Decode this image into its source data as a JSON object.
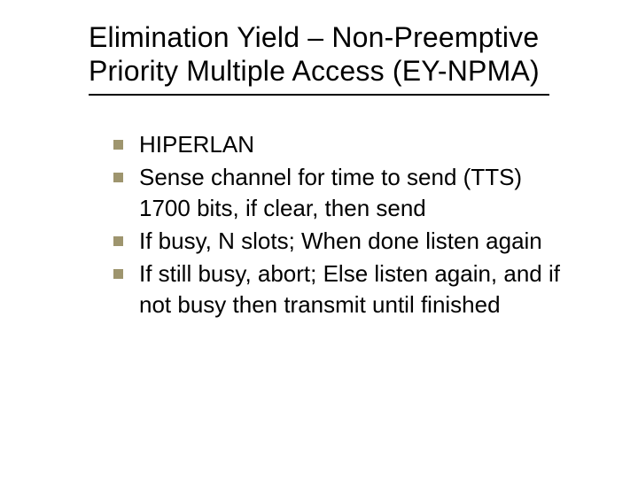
{
  "title": "Elimination Yield – Non-Preemptive Priority Multiple Access (EY-NPMA)",
  "bullets": [
    {
      "text": "HIPERLAN"
    },
    {
      "text": "Sense channel for time to send (TTS) 1700 bits, if clear, then send"
    },
    {
      "text": "If busy, N slots;  When done listen again"
    },
    {
      "text": "If still busy, abort; Else listen again, and if not busy then transmit until finished"
    }
  ],
  "colors": {
    "bullet": "#9e956e",
    "text": "#000000",
    "background": "#ffffff"
  }
}
